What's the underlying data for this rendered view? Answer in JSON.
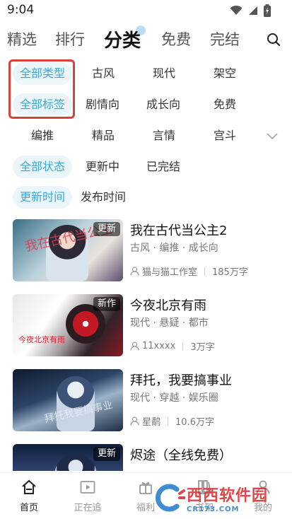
{
  "status_bar": {
    "time": "9:04"
  },
  "top_nav": {
    "tabs": [
      "精选",
      "排行",
      "分类",
      "免费",
      "完结"
    ],
    "active_index": 2
  },
  "filters": {
    "type_row1": [
      "全部类型",
      "古风",
      "现代",
      "架空"
    ],
    "type_row2": [
      "全部标签",
      "剧情向",
      "成长向",
      "免费"
    ],
    "type_row3": [
      "编推",
      "精品",
      "言情",
      "宫斗"
    ],
    "status_row": [
      "全部状态",
      "更新中",
      "已完结"
    ],
    "sort_row": [
      "更新时间",
      "发布时间"
    ]
  },
  "books": [
    {
      "title": "我在古代当公主2",
      "tags": "古风 · 编推 · 成长向",
      "author": "猫与猫工作室",
      "words": "185万字",
      "badge": "更新",
      "cover_text": "我在古代当公主"
    },
    {
      "title": "今夜北京有雨",
      "tags": "现代 · 悬疑 · 都市",
      "author": "11xxxx",
      "words": "3万字",
      "badge": "新作",
      "cover_text": "今夜北京有雨"
    },
    {
      "title": "拜托，我要搞事业",
      "tags": "现代 · 穿越 · 娱乐圈",
      "author": "星鹬",
      "words": "10.6万字",
      "badge": "",
      "cover_text": "拜托我要搞事业"
    },
    {
      "title": "烬途（全线免费）",
      "tags": "",
      "author": "",
      "words": "",
      "badge": "更新",
      "cover_text": ""
    }
  ],
  "bottom_nav": {
    "items": [
      "首页",
      "正在追",
      "福利",
      "书架",
      "我的"
    ],
    "active_index": 0
  },
  "watermark": {
    "main": "西西软件园",
    "sub": "CR173.COM"
  },
  "colors": {
    "accent": "#3aa7d6",
    "chip_bg": "#ebf6fb",
    "highlight": "#d4433b"
  }
}
